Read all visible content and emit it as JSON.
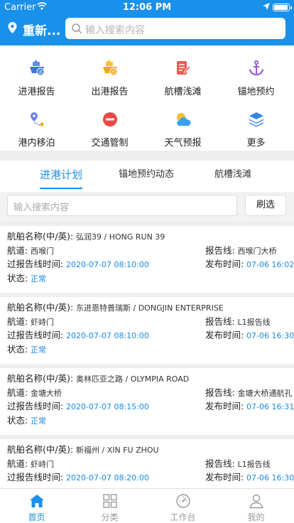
{
  "status_bar": {
    "carrier": "Carrier",
    "time": "12:06 PM"
  },
  "header": {
    "location": "重新...",
    "search_placeholder": "输入搜索内容"
  },
  "menu": [
    {
      "label": "进港报告",
      "icon": "ship-in-icon"
    },
    {
      "label": "出港报告",
      "icon": "ship-out-icon"
    },
    {
      "label": "航槽浅滩",
      "icon": "document-edit-icon"
    },
    {
      "label": "锚地预约",
      "icon": "anchor-icon"
    },
    {
      "label": "港内移泊",
      "icon": "route-pin-icon"
    },
    {
      "label": "交通管制",
      "icon": "no-entry-icon"
    },
    {
      "label": "天气预报",
      "icon": "weather-icon"
    },
    {
      "label": "更多",
      "icon": "layers-icon"
    }
  ],
  "tabs": [
    "进港计划",
    "锚地预约动态",
    "航槽浅滩"
  ],
  "list_search": {
    "placeholder": "输入搜索内容",
    "button": "刷选"
  },
  "labels": {
    "ship_name": "航舶名称(中/英):",
    "channel": "航道:",
    "report_line": "报告线:",
    "pass_time": "过报告线时间:",
    "publish_time": "发布时间:",
    "status": "状态:"
  },
  "records": [
    {
      "ship_name": "弘润39 / HONG RUN 39",
      "channel": "西堠门",
      "report_line": "西堠门大桥",
      "pass_time": "2020-07-07 08:10:00",
      "publish_time": "07-06 16:02",
      "status": "正常"
    },
    {
      "ship_name": "东进恩特普瑞斯 / DONGJIN ENTERPRISE",
      "channel": "虾峙门",
      "report_line": "L1报告线",
      "pass_time": "2020-07-07 08:10:00",
      "publish_time": "07-06 16:30",
      "status": "正常"
    },
    {
      "ship_name": "奥林匹亚之路 / OLYMPIA ROAD",
      "channel": "金塘大桥",
      "report_line": "金塘大桥通航孔",
      "pass_time": "2020-07-07 08:15:00",
      "publish_time": "07-06 16:31",
      "status": "正常"
    },
    {
      "ship_name": "新福州 / XIN FU ZHOU",
      "channel": "虾峙门",
      "report_line": "L1报告线",
      "pass_time": "2020-07-07 08:20:00",
      "publish_time": "07-06 16:30",
      "status": ""
    }
  ],
  "bottom_nav": [
    {
      "label": "首页",
      "icon": "home-icon",
      "active": true
    },
    {
      "label": "分类",
      "icon": "grid-icon",
      "active": false
    },
    {
      "label": "工作台",
      "icon": "dashboard-icon",
      "active": false
    },
    {
      "label": "我的",
      "icon": "user-icon",
      "active": false
    }
  ],
  "colors": {
    "primary": "#1990ea",
    "value_blue": "#1a8ae0",
    "background": "#eeeeee"
  }
}
